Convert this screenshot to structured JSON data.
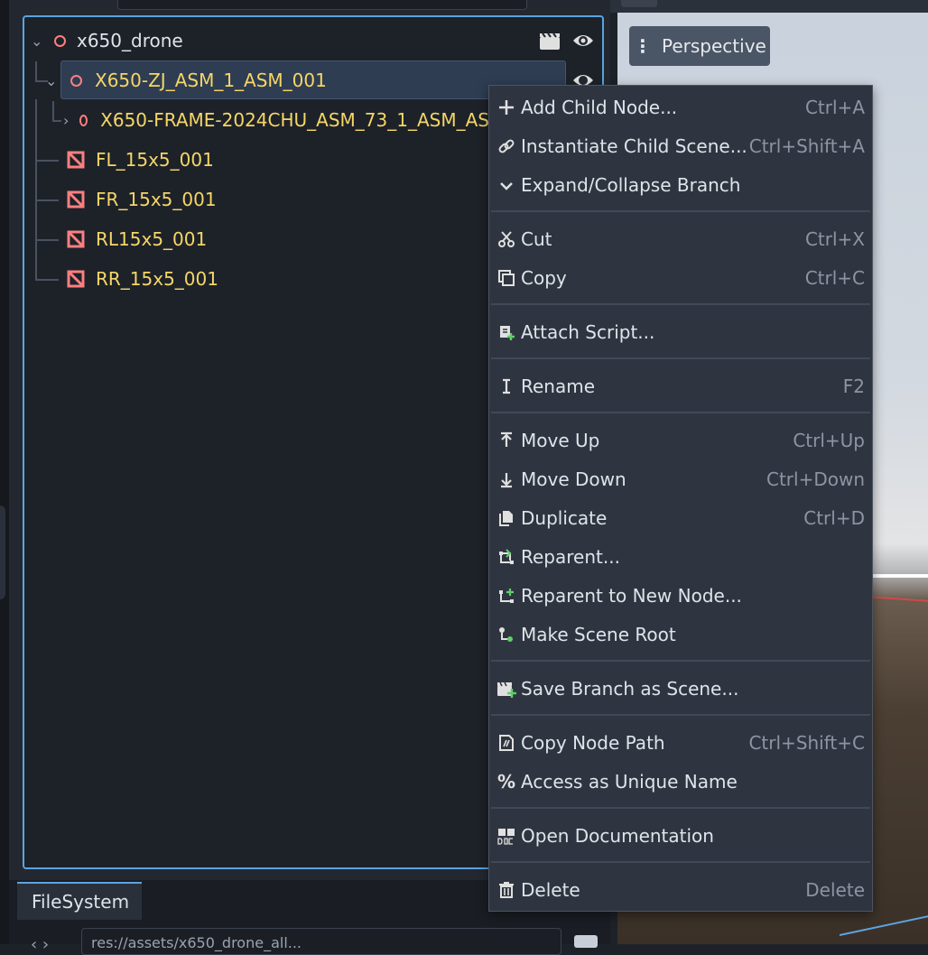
{
  "scene_tree": {
    "root": {
      "label": "x650_drone"
    },
    "nodes": [
      {
        "label": "X650-ZJ_ASM_1_ASM_001"
      },
      {
        "label": "X650-FRAME-2024CHU_ASM_73_1_ASM_AS"
      },
      {
        "label": "FL_15x5_001"
      },
      {
        "label": "FR_15x5_001"
      },
      {
        "label": "RL15x5_001"
      },
      {
        "label": "RR_15x5_001"
      }
    ]
  },
  "filesystem": {
    "tab_label": "FileSystem",
    "path": "res://assets/x650_drone_all..."
  },
  "viewport": {
    "perspective_label": "Perspective"
  },
  "context_menu": {
    "items": [
      {
        "label": "Add Child Node...",
        "shortcut": "Ctrl+A",
        "icon": "plus-icon"
      },
      {
        "label": "Instantiate Child Scene...",
        "shortcut": "Ctrl+Shift+A",
        "icon": "link-icon"
      },
      {
        "label": "Expand/Collapse Branch",
        "shortcut": "",
        "icon": "chevron-down-icon"
      },
      {
        "label": "Cut",
        "shortcut": "Ctrl+X",
        "icon": "scissors-icon"
      },
      {
        "label": "Copy",
        "shortcut": "Ctrl+C",
        "icon": "copy-icon"
      },
      {
        "label": "Attach Script...",
        "shortcut": "",
        "icon": "script-add-icon"
      },
      {
        "label": "Rename",
        "shortcut": "F2",
        "icon": "text-cursor-icon"
      },
      {
        "label": "Move Up",
        "shortcut": "Ctrl+Up",
        "icon": "arrow-up-icon"
      },
      {
        "label": "Move Down",
        "shortcut": "Ctrl+Down",
        "icon": "arrow-down-icon"
      },
      {
        "label": "Duplicate",
        "shortcut": "Ctrl+D",
        "icon": "duplicate-icon"
      },
      {
        "label": "Reparent...",
        "shortcut": "",
        "icon": "reparent-icon"
      },
      {
        "label": "Reparent to New Node...",
        "shortcut": "",
        "icon": "reparent-new-icon"
      },
      {
        "label": "Make Scene Root",
        "shortcut": "",
        "icon": "scene-root-icon"
      },
      {
        "label": "Save Branch as Scene...",
        "shortcut": "",
        "icon": "clapper-add-icon"
      },
      {
        "label": "Copy Node Path",
        "shortcut": "Ctrl+Shift+C",
        "icon": "node-path-icon"
      },
      {
        "label": "Access as Unique Name",
        "shortcut": "",
        "icon": "percent-icon"
      },
      {
        "label": "Open Documentation",
        "shortcut": "",
        "icon": "doc-icon"
      },
      {
        "label": "Delete",
        "shortcut": "Delete",
        "icon": "trash-icon"
      }
    ]
  },
  "colors": {
    "accent": "#5ba3e0",
    "node_3d": "#fc7f7f",
    "instanced_text": "#f6d667",
    "menu_bg": "#2f3540"
  }
}
